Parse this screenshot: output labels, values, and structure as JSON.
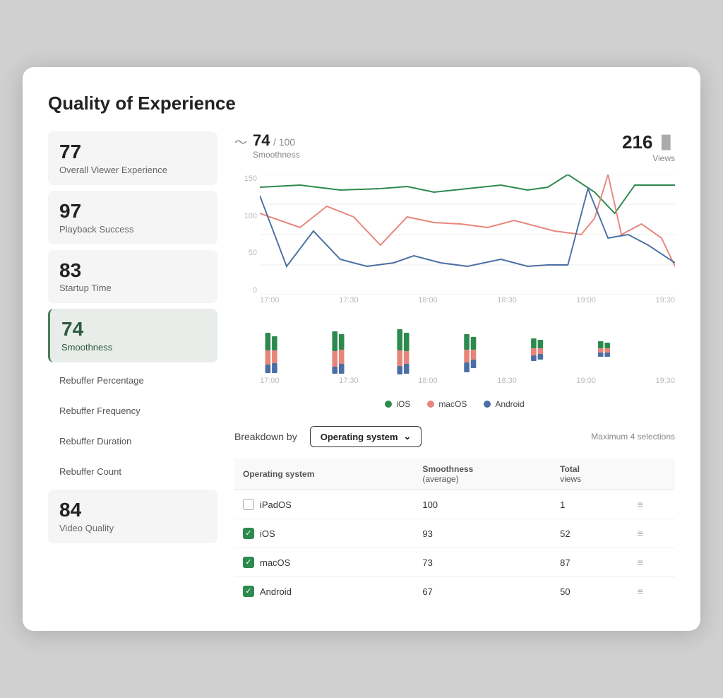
{
  "page": {
    "title": "Quality of Experience"
  },
  "sidebar": {
    "metrics": [
      {
        "id": "overall",
        "value": "77",
        "label": "Overall Viewer Experience",
        "active": false
      },
      {
        "id": "playback",
        "value": "97",
        "label": "Playback Success",
        "active": false
      },
      {
        "id": "startup",
        "value": "83",
        "label": "Startup Time",
        "active": false
      },
      {
        "id": "smoothness",
        "value": "74",
        "label": "Smoothness",
        "active": true
      },
      {
        "id": "video_quality",
        "value": "84",
        "label": "Video Quality",
        "active": false
      }
    ],
    "links": [
      {
        "id": "rebuffer_pct",
        "label": "Rebuffer Percentage"
      },
      {
        "id": "rebuffer_freq",
        "label": "Rebuffer Frequency"
      },
      {
        "id": "rebuffer_dur",
        "label": "Rebuffer Duration"
      },
      {
        "id": "rebuffer_cnt",
        "label": "Rebuffer Count"
      }
    ]
  },
  "chart_header": {
    "score": "74",
    "max": "100",
    "metric_name": "Smoothness",
    "views_count": "216",
    "views_label": "Views"
  },
  "y_axis": [
    "150",
    "100",
    "50",
    "0"
  ],
  "x_axis": [
    "17:00",
    "17:30",
    "18:00",
    "18:30",
    "19:00",
    "19:30"
  ],
  "legend": [
    {
      "id": "ios",
      "label": "iOS",
      "color": "#2d8a4e"
    },
    {
      "id": "macos",
      "label": "macOS",
      "color": "#e8857a"
    },
    {
      "id": "android",
      "label": "Android",
      "color": "#4a6fa5"
    }
  ],
  "breakdown": {
    "label": "Breakdown by",
    "dropdown_text": "Operating system",
    "max_selections": "Maximum 4 selections",
    "table": {
      "col1": "Operating system",
      "col2": "Smoothness (average)",
      "col3": "Total views",
      "rows": [
        {
          "os": "iPadOS",
          "checked": false,
          "smoothness": "100",
          "views": "1"
        },
        {
          "os": "iOS",
          "checked": true,
          "smoothness": "93",
          "views": "52"
        },
        {
          "os": "macOS",
          "checked": true,
          "smoothness": "73",
          "views": "87"
        },
        {
          "os": "Android",
          "checked": true,
          "smoothness": "67",
          "views": "50"
        }
      ]
    }
  }
}
